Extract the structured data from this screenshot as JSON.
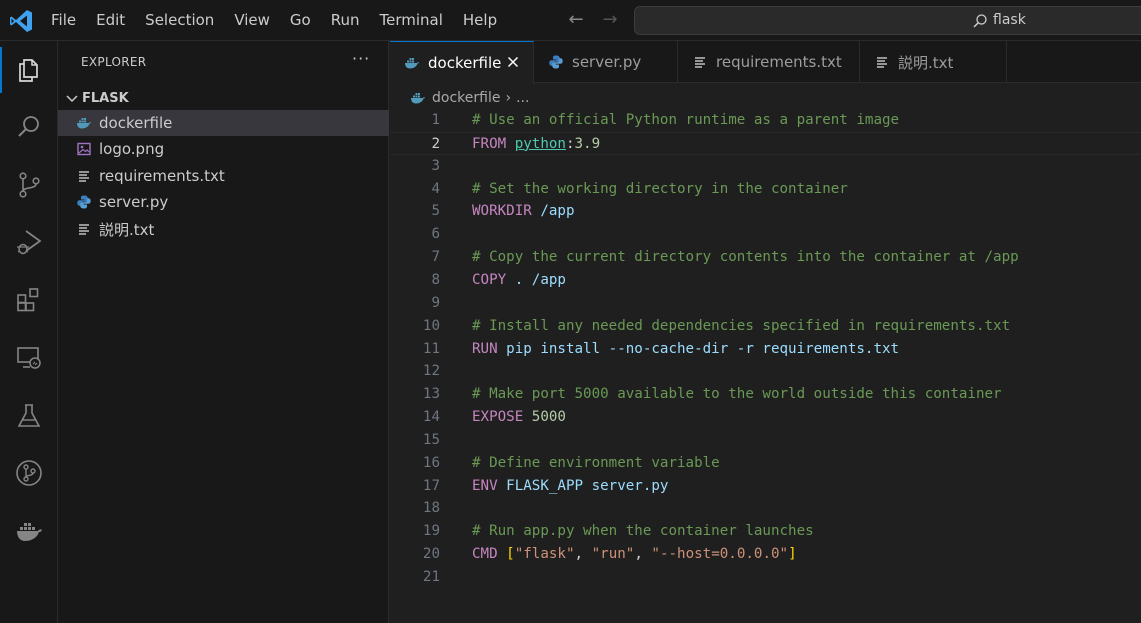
{
  "menu": [
    "File",
    "Edit",
    "Selection",
    "View",
    "Go",
    "Run",
    "Terminal",
    "Help"
  ],
  "search": {
    "text": "flask"
  },
  "nav": {
    "back": "←",
    "forward": "→"
  },
  "activity_bar": [
    {
      "name": "explorer-icon",
      "active": true
    },
    {
      "name": "search-icon"
    },
    {
      "name": "source-control-icon"
    },
    {
      "name": "run-debug-icon"
    },
    {
      "name": "extensions-icon"
    },
    {
      "name": "remote-explorer-icon"
    },
    {
      "name": "testing-icon"
    },
    {
      "name": "git-graph-icon"
    },
    {
      "name": "docker-icon"
    }
  ],
  "sidebar": {
    "title": "EXPLORER",
    "more": "···",
    "folder": "FLASK",
    "files": [
      {
        "name": "dockerfile",
        "icon": "docker-file-icon",
        "selected": true
      },
      {
        "name": "logo.png",
        "icon": "image-file-icon"
      },
      {
        "name": "requirements.txt",
        "icon": "text-file-icon"
      },
      {
        "name": "server.py",
        "icon": "python-file-icon"
      },
      {
        "name": "説明.txt",
        "icon": "text-file-icon"
      }
    ]
  },
  "tabs": [
    {
      "label": "dockerfile",
      "icon": "docker-file-icon",
      "active": true
    },
    {
      "label": "server.py",
      "icon": "python-file-icon"
    },
    {
      "label": "requirements.txt",
      "icon": "text-file-icon"
    },
    {
      "label": "説明.txt",
      "icon": "text-file-icon"
    }
  ],
  "breadcrumb": {
    "file": "dockerfile",
    "sep": "›",
    "more": "..."
  },
  "editor": {
    "current_line": 2,
    "lines": [
      {
        "n": "1",
        "tokens": [
          [
            "c-comment",
            "# Use an official Python runtime as a parent image"
          ]
        ]
      },
      {
        "n": "2",
        "tokens": [
          [
            "c-keyword",
            "FROM"
          ],
          [
            "c-punct",
            " "
          ],
          [
            "c-image",
            "python"
          ],
          [
            "c-colon",
            ":"
          ],
          [
            "c-num",
            "3.9"
          ]
        ]
      },
      {
        "n": "3",
        "tokens": []
      },
      {
        "n": "4",
        "tokens": [
          [
            "c-comment",
            "# Set the working directory in the container"
          ]
        ]
      },
      {
        "n": "5",
        "tokens": [
          [
            "c-keyword",
            "WORKDIR"
          ],
          [
            "c-default",
            " /app"
          ]
        ]
      },
      {
        "n": "6",
        "tokens": []
      },
      {
        "n": "7",
        "tokens": [
          [
            "c-comment",
            "# Copy the current directory contents into the container at /app"
          ]
        ]
      },
      {
        "n": "8",
        "tokens": [
          [
            "c-keyword",
            "COPY"
          ],
          [
            "c-default",
            " . /app"
          ]
        ]
      },
      {
        "n": "9",
        "tokens": []
      },
      {
        "n": "10",
        "tokens": [
          [
            "c-comment",
            "# Install any needed dependencies specified in requirements.txt"
          ]
        ]
      },
      {
        "n": "11",
        "tokens": [
          [
            "c-keyword",
            "RUN"
          ],
          [
            "c-default",
            " pip install --no-cache-dir -r requirements.txt"
          ]
        ]
      },
      {
        "n": "12",
        "tokens": []
      },
      {
        "n": "13",
        "tokens": [
          [
            "c-comment",
            "# Make port 5000 available to the world outside this container"
          ]
        ]
      },
      {
        "n": "14",
        "tokens": [
          [
            "c-keyword",
            "EXPOSE"
          ],
          [
            "c-punct",
            " "
          ],
          [
            "c-num",
            "5000"
          ]
        ]
      },
      {
        "n": "15",
        "tokens": []
      },
      {
        "n": "16",
        "tokens": [
          [
            "c-comment",
            "# Define environment variable"
          ]
        ]
      },
      {
        "n": "17",
        "tokens": [
          [
            "c-keyword",
            "ENV"
          ],
          [
            "c-default",
            " FLASK_APP server.py"
          ]
        ]
      },
      {
        "n": "18",
        "tokens": []
      },
      {
        "n": "19",
        "tokens": [
          [
            "c-comment",
            "# Run app.py when the container launches"
          ]
        ]
      },
      {
        "n": "20",
        "tokens": [
          [
            "c-keyword",
            "CMD"
          ],
          [
            "c-punct",
            " "
          ],
          [
            "c-bracket",
            "["
          ],
          [
            "c-str",
            "\"flask\""
          ],
          [
            "c-punct",
            ", "
          ],
          [
            "c-str",
            "\"run\""
          ],
          [
            "c-punct",
            ", "
          ],
          [
            "c-str",
            "\"--host=0.0.0.0\""
          ],
          [
            "c-bracket",
            "]"
          ]
        ]
      },
      {
        "n": "21",
        "tokens": []
      }
    ]
  },
  "colors": {
    "accent": "#0078d4",
    "comment": "#6a9955",
    "keyword": "#c586c0",
    "docker_blue": "#519aba",
    "python_blue": "#3c7ebf"
  }
}
